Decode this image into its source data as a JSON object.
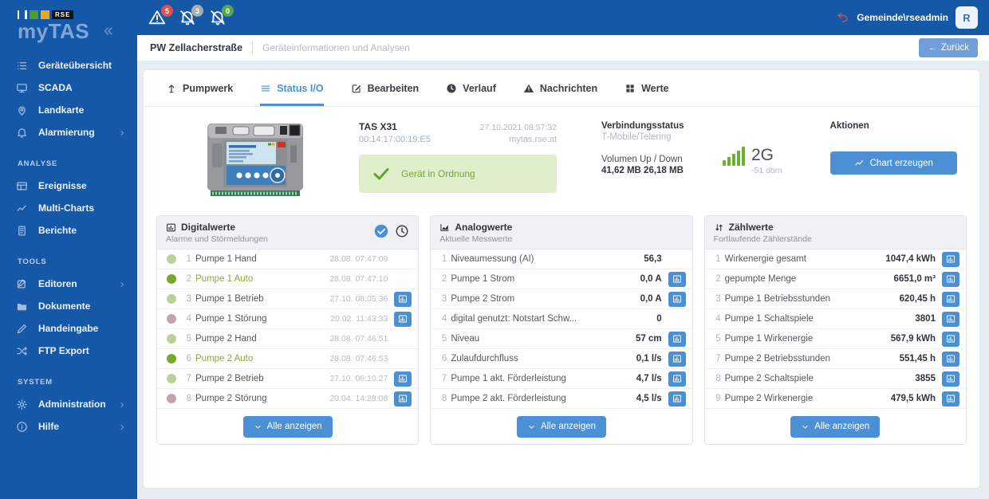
{
  "colors": {
    "accent_blue": "#4b90d4",
    "sidebar_blue": "#1658a8",
    "state_on": "#79a62c",
    "state_on_light": "#b9d09a",
    "state_fault": "#c3a4ad",
    "badge_red": "#d9534f",
    "badge_gray": "#a6adb5",
    "badge_green": "#56a854",
    "status_green_bg": "#dfeecb",
    "signal_green": "#68b32a"
  },
  "sidebar": {
    "brand": "RSE",
    "app_title": "myTAS",
    "sections": [
      {
        "label": "",
        "items": [
          {
            "label": "Geräteübersicht",
            "icon": "list-icon",
            "chevron": false
          },
          {
            "label": "SCADA",
            "icon": "monitor-icon",
            "chevron": false
          },
          {
            "label": "Landkarte",
            "icon": "map-pin-icon",
            "chevron": false
          },
          {
            "label": "Alarmierung",
            "icon": "bell-icon",
            "chevron": true
          }
        ]
      },
      {
        "label": "ANALYSE",
        "items": [
          {
            "label": "Ereignisse",
            "icon": "table-icon",
            "chevron": false
          },
          {
            "label": "Multi-Charts",
            "icon": "chart-line-icon",
            "chevron": false
          },
          {
            "label": "Berichte",
            "icon": "report-icon",
            "chevron": false
          }
        ]
      },
      {
        "label": "TOOLS",
        "items": [
          {
            "label": "Editoren",
            "icon": "editor-icon",
            "chevron": true
          },
          {
            "label": "Dokumente",
            "icon": "folder-icon",
            "chevron": false
          },
          {
            "label": "Handeingabe",
            "icon": "pencil-icon",
            "chevron": false
          },
          {
            "label": "FTP Export",
            "icon": "shuffle-icon",
            "chevron": false
          }
        ]
      },
      {
        "label": "SYSTEM",
        "items": [
          {
            "label": "Administration",
            "icon": "gear-icon",
            "chevron": true
          },
          {
            "label": "Hilfe",
            "icon": "help-icon",
            "chevron": true
          }
        ]
      }
    ]
  },
  "header": {
    "alarms": [
      {
        "icon": "warning-triangle-icon",
        "count": "5",
        "badge_color": "#d9534f"
      },
      {
        "icon": "bell-slash-icon",
        "count": "3",
        "badge_color": "#a6adb5"
      },
      {
        "icon": "bell-slash-icon",
        "count": "0",
        "badge_color": "#56a854"
      }
    ],
    "user_name": "Gemeinde\\rseadmin",
    "avatar_letter": "R"
  },
  "breadcrumb": {
    "title": "PW Zellacherstraße",
    "subtitle": "Geräteinformationen und Analysen",
    "back_label": "Zurück"
  },
  "tabs": [
    {
      "label": "Pumpwerk",
      "icon": "pump-icon",
      "active": false
    },
    {
      "label": "Status I/O",
      "icon": "hamburger-icon",
      "active": true
    },
    {
      "label": "Bearbeiten",
      "icon": "edit-icon",
      "active": false
    },
    {
      "label": "Verlauf",
      "icon": "clock-filled-icon",
      "active": false
    },
    {
      "label": "Nachrichten",
      "icon": "warning-filled-icon",
      "active": false
    },
    {
      "label": "Werte",
      "icon": "grid-icon",
      "active": false
    }
  ],
  "device": {
    "name": "TAS X31",
    "mac": "00:14:17:00:19:E5",
    "datetime": "27.10.2021 08:57:32",
    "host": "mytas.rse.at",
    "status_text": "Gerät in Ordnung",
    "connection_label": "Verbindungsstatus",
    "connection_value": "T-Mobile/Telering",
    "volume_label": "Volumen Up / Down",
    "volume_value": "41,62 MB 26,18 MB",
    "signal_type": "2G",
    "signal_strength": "-51 dbm",
    "actions_label": "Aktionen",
    "chart_button_label": "Chart erzeugen"
  },
  "panels": {
    "digital": {
      "title": "Digitalwerte",
      "subtitle": "Alarme und Störmeldungen",
      "icon": "chart-box-icon",
      "header_icons": [
        "check-circle-icon",
        "clock-icon"
      ],
      "show_all_label": "Alle anzeigen",
      "rows": [
        {
          "num": "1",
          "label": "Pumpe 1 Hand",
          "time": "28.08. 07:47:09",
          "state": "on_light",
          "active": false,
          "chart": false
        },
        {
          "num": "2",
          "label": "Pumpe 1 Auto",
          "time": "28.08. 07:47:10",
          "state": "on",
          "active": true,
          "chart": false
        },
        {
          "num": "3",
          "label": "Pumpe 1 Betrieb",
          "time": "27.10. 08:05:36",
          "state": "on_light",
          "active": false,
          "chart": true
        },
        {
          "num": "4",
          "label": "Pumpe 1 Störung",
          "time": "20.02. 11:43:33",
          "state": "fault",
          "active": false,
          "chart": true
        },
        {
          "num": "5",
          "label": "Pumpe 2 Hand",
          "time": "28.08. 07:46:51",
          "state": "on_light",
          "active": false,
          "chart": false
        },
        {
          "num": "6",
          "label": "Pumpe 2 Auto",
          "time": "28.08. 07:46:53",
          "state": "on",
          "active": true,
          "chart": false
        },
        {
          "num": "7",
          "label": "Pumpe 2 Betrieb",
          "time": "27.10. 06:10:27",
          "state": "on_light",
          "active": false,
          "chart": true
        },
        {
          "num": "8",
          "label": "Pumpe 2 Störung",
          "time": "20.04. 14:28:08",
          "state": "fault",
          "active": false,
          "chart": true
        }
      ]
    },
    "analog": {
      "title": "Analogwerte",
      "subtitle": "Aktuelle Messwerte",
      "icon": "area-chart-icon",
      "show_all_label": "Alle anzeigen",
      "rows": [
        {
          "num": "1",
          "label": "Niveaumessung (AI)",
          "value": "56,3",
          "chart": false
        },
        {
          "num": "2",
          "label": "Pumpe 1 Strom",
          "value": "0,0 A",
          "chart": true
        },
        {
          "num": "3",
          "label": "Pumpe 2 Strom",
          "value": "0,0 A",
          "chart": true
        },
        {
          "num": "4",
          "label": "digital genutzt: Notstart Schw...",
          "value": "0",
          "chart": false
        },
        {
          "num": "5",
          "label": "Niveau",
          "value": "57 cm",
          "chart": true
        },
        {
          "num": "6",
          "label": "Zulaufdurchfluss",
          "value": "0,1 l/s",
          "chart": true
        },
        {
          "num": "7",
          "label": "Pumpe 1 akt. Förderleistung",
          "value": "4,7 l/s",
          "chart": true
        },
        {
          "num": "8",
          "label": "Pumpe 2 akt. Förderleistung",
          "value": "4,5 l/s",
          "chart": true
        }
      ]
    },
    "counter": {
      "title": "Zählwerte",
      "subtitle": "Fortlaufende Zählerstände",
      "icon": "sort-updown-icon",
      "show_all_label": "Alle anzeigen",
      "rows": [
        {
          "num": "1",
          "label": "Wirkenergie gesamt",
          "value": "1047,4 kWh",
          "chart": true
        },
        {
          "num": "2",
          "label": "gepumpte Menge",
          "value": "6651,0 m³",
          "chart": true
        },
        {
          "num": "3",
          "label": "Pumpe 1 Betriebsstunden",
          "value": "620,45 h",
          "chart": true
        },
        {
          "num": "4",
          "label": "Pumpe 1 Schaltspiele",
          "value": "3801",
          "chart": true
        },
        {
          "num": "5",
          "label": "Pumpe 1 Wirkenergie",
          "value": "567,9 kWh",
          "chart": true
        },
        {
          "num": "7",
          "label": "Pumpe 2 Betriebsstunden",
          "value": "551,45 h",
          "chart": true
        },
        {
          "num": "8",
          "label": "Pumpe 2 Schaltspiele",
          "value": "3855",
          "chart": true
        },
        {
          "num": "9",
          "label": "Pumpe 2 Wirkenergie",
          "value": "479,5 kWh",
          "chart": true
        }
      ]
    }
  }
}
